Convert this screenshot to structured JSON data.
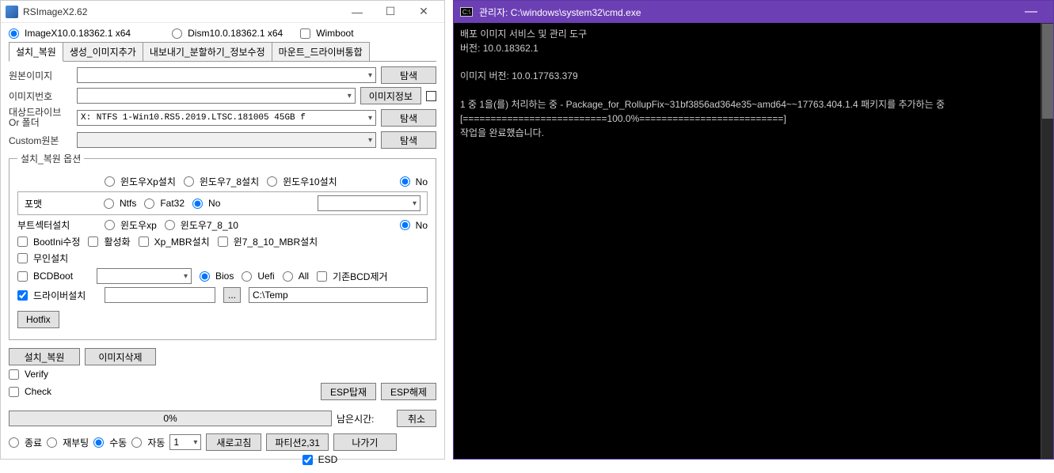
{
  "app": {
    "title": "RSImageX2.62",
    "topbar": {
      "imagex_label": "ImageX10.0.18362.1 x64",
      "dism_label": "Dism10.0.18362.1 x64",
      "wimboot_label": "Wimboot"
    },
    "tabs": {
      "t1": "설치_복원",
      "t2": "생성_이미지추가",
      "t3": "내보내기_분할하기_정보수정",
      "t4": "마운트_드라이버통합"
    },
    "labels": {
      "source_img": "원본이미지",
      "img_number": "이미지번호",
      "target_drive": "대상드라이브\nOr 폴더",
      "custom_src": "Custom원본",
      "browse": "탐색",
      "img_info": "이미지정보"
    },
    "drive_value": "X:  NTFS  1-Win10.RS5.2019.LTSC.181005       45GB  f",
    "opts": {
      "legend": "설치_복원 옵션",
      "winxp": "윈도우Xp설치",
      "win78": "윈도우7_8설치",
      "win10": "윈도우10설치",
      "no": "No",
      "format": "포맷",
      "ntfs": "Ntfs",
      "fat32": "Fat32",
      "bootsec": "부트섹터설치",
      "wxp": "윈도우xp",
      "w7810": "윈도우7_8_10",
      "bootini": "BootIni수정",
      "activate": "활성화",
      "xpmbr": "Xp_MBR설치",
      "w7810mbr": "윈7_8_10_MBR설치",
      "unattend": "무인설치",
      "bcdboot": "BCDBoot",
      "bios": "Bios",
      "uefi": "Uefi",
      "all": "All",
      "keep_bcd": "기존BCD제거",
      "driver_install": "드라이버설치",
      "temp_path": "C:\\Temp",
      "hotfix": "Hotfix"
    },
    "actions": {
      "install_restore": "설치_복원",
      "delete_image": "이미지삭제",
      "verify": "Verify",
      "check": "Check",
      "esp_mount": "ESP탑재",
      "esp_unmount": "ESP해제",
      "remain_time": "남은시간:",
      "cancel": "취소",
      "progress": "0%",
      "shutdown": "종료",
      "reboot": "재부팅",
      "manual": "수동",
      "auto": "자동",
      "spin_val": "1",
      "refresh": "새로고침",
      "partition": "파티션2,31",
      "exit": "나가기",
      "esd": "ESD"
    }
  },
  "cmd": {
    "title": "관리자: C:\\windows\\system32\\cmd.exe",
    "lines": {
      "l1": "배포 이미지 서비스 및 관리 도구",
      "l2": "버전: 10.0.18362.1",
      "l3": "",
      "l4": "이미지 버전: 10.0.17763.379",
      "l5": "",
      "l6": "1 중 1을(를) 처리하는 중 - Package_for_RollupFix~31bf3856ad364e35~amd64~~17763.404.1.4 패키지를 추가하는 중",
      "l7": "[==========================100.0%==========================]",
      "l8": "작업을 완료했습니다."
    }
  }
}
